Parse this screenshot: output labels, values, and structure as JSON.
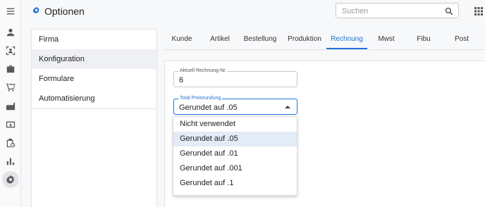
{
  "header": {
    "title": "Optionen",
    "title_icon": "gear-icon",
    "search_placeholder": "Suchen",
    "accent_color": "#1e73d8"
  },
  "rail": {
    "icons": [
      "menu-icon",
      "person-icon",
      "contact-scan-icon",
      "briefcase-icon",
      "cart-icon",
      "factory-icon",
      "dollar-icon",
      "clipboard-clock-icon",
      "bar-chart-icon",
      "settings-icon"
    ],
    "active": "settings-icon"
  },
  "sidebar": {
    "items": [
      {
        "label": "Firma",
        "active": false
      },
      {
        "label": "Konfiguration",
        "active": true
      },
      {
        "label": "Formulare",
        "active": false
      },
      {
        "label": "Automatisierung",
        "active": false
      }
    ]
  },
  "tabs": [
    {
      "label": "Kunde",
      "active": false
    },
    {
      "label": "Artikel",
      "active": false
    },
    {
      "label": "Bestellung",
      "active": false
    },
    {
      "label": "Produktion",
      "active": false
    },
    {
      "label": "Rechnung",
      "active": true
    },
    {
      "label": "Mwst",
      "active": false
    },
    {
      "label": "Fibu",
      "active": false
    },
    {
      "label": "Post",
      "active": false
    }
  ],
  "form": {
    "invoice_number": {
      "label": "Aktuell Rechnung-Nr.",
      "value": "6"
    },
    "price_rounding": {
      "label": "Total Preisrundung",
      "value": "Gerundet auf .05"
    }
  },
  "dropdown": {
    "options": [
      {
        "label": "Nicht verwendet",
        "selected": false
      },
      {
        "label": "Gerundet auf .05",
        "selected": true
      },
      {
        "label": "Gerundet auf .01",
        "selected": false
      },
      {
        "label": "Gerundet auf .001",
        "selected": false
      },
      {
        "label": "Gerundet auf .1",
        "selected": false
      }
    ]
  }
}
